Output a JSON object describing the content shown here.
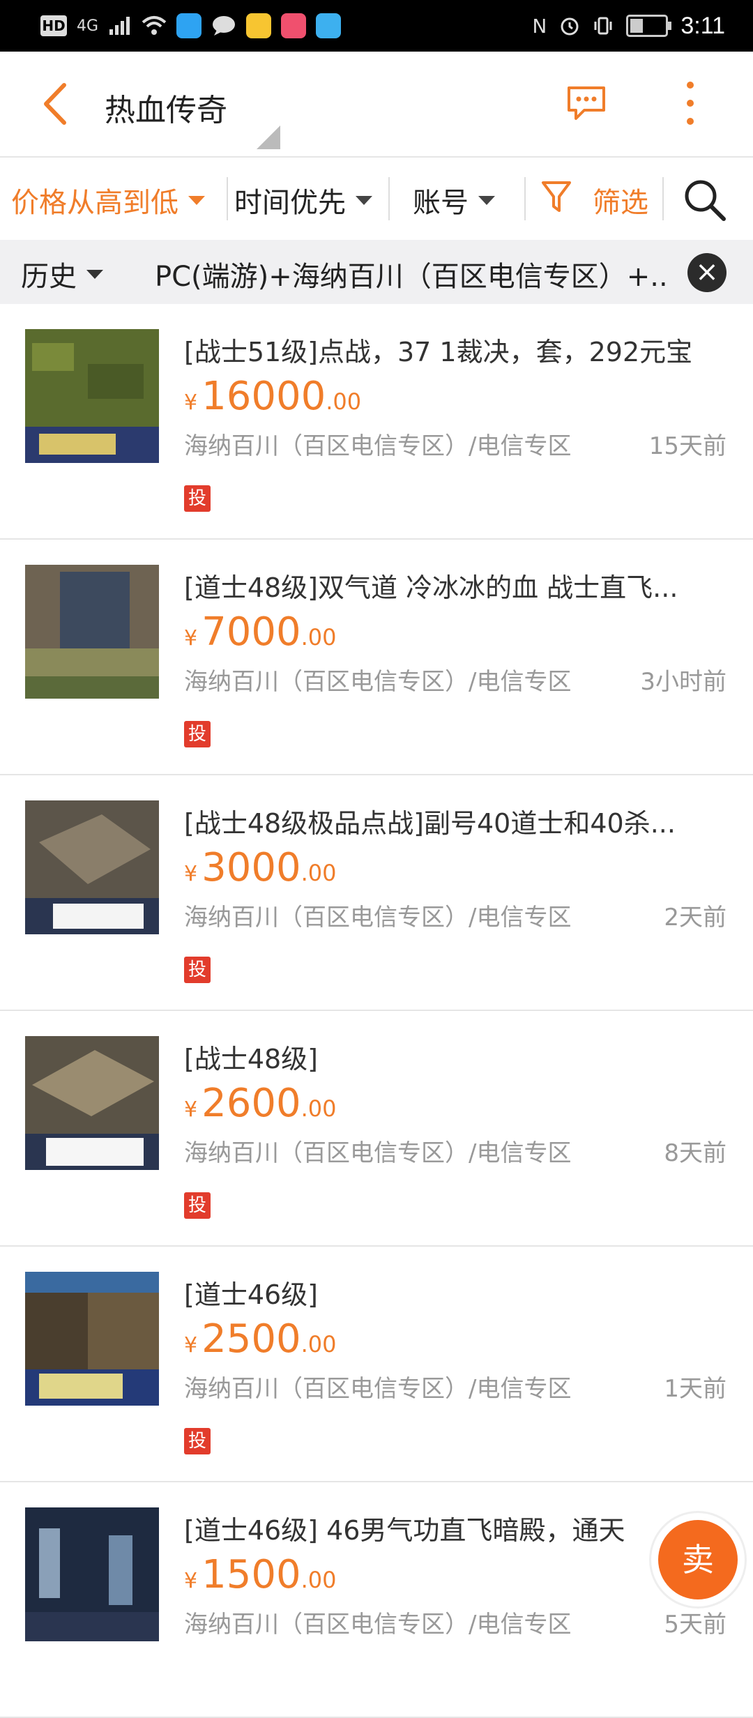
{
  "status_bar": {
    "left_badges": [
      "HD",
      "4G"
    ],
    "time": "3:11"
  },
  "header": {
    "title": "热血传奇",
    "back_icon": "chevron-left-icon",
    "message_icon": "chat-icon",
    "more_icon": "more-vertical-icon",
    "accent_color": "#f07d2a"
  },
  "filters": {
    "sort_price": "价格从高到低",
    "sort_time": "时间优先",
    "type": "账号",
    "filter_label": "筛选",
    "search_icon": "search-icon"
  },
  "history": {
    "label": "历史",
    "tag": "PC(端游)+海纳百川（百区电信专区）+.."
  },
  "listings": [
    {
      "title": "[战士51级]点战，37 1裁决，套，292元宝",
      "price_int": "16000",
      "price_dec": ".00",
      "currency": "¥",
      "server": "海纳百川（百区电信专区）/电信专区",
      "time": "15天前",
      "badge": "投"
    },
    {
      "title": "[道士48级]双气道 冷冰冰的血 战士直飞...",
      "price_int": "7000",
      "price_dec": ".00",
      "currency": "¥",
      "server": "海纳百川（百区电信专区）/电信专区",
      "time": "3小时前",
      "badge": "投"
    },
    {
      "title": "[战士48级极品点战]副号40道士和40杀...",
      "price_int": "3000",
      "price_dec": ".00",
      "currency": "¥",
      "server": "海纳百川（百区电信专区）/电信专区",
      "time": "2天前",
      "badge": "投"
    },
    {
      "title": "[战士48级]",
      "price_int": "2600",
      "price_dec": ".00",
      "currency": "¥",
      "server": "海纳百川（百区电信专区）/电信专区",
      "time": "8天前",
      "badge": "投"
    },
    {
      "title": "[道士46级]",
      "price_int": "2500",
      "price_dec": ".00",
      "currency": "¥",
      "server": "海纳百川（百区电信专区）/电信专区",
      "time": "1天前",
      "badge": "投"
    },
    {
      "title": "[道士46级]  46男气功直飞暗殿，通天",
      "price_int": "1500",
      "price_dec": ".00",
      "currency": "¥",
      "server": "海纳百川（百区电信专区）/电信专区",
      "time": "5天前",
      "badge": ""
    }
  ],
  "sell_button": "卖"
}
